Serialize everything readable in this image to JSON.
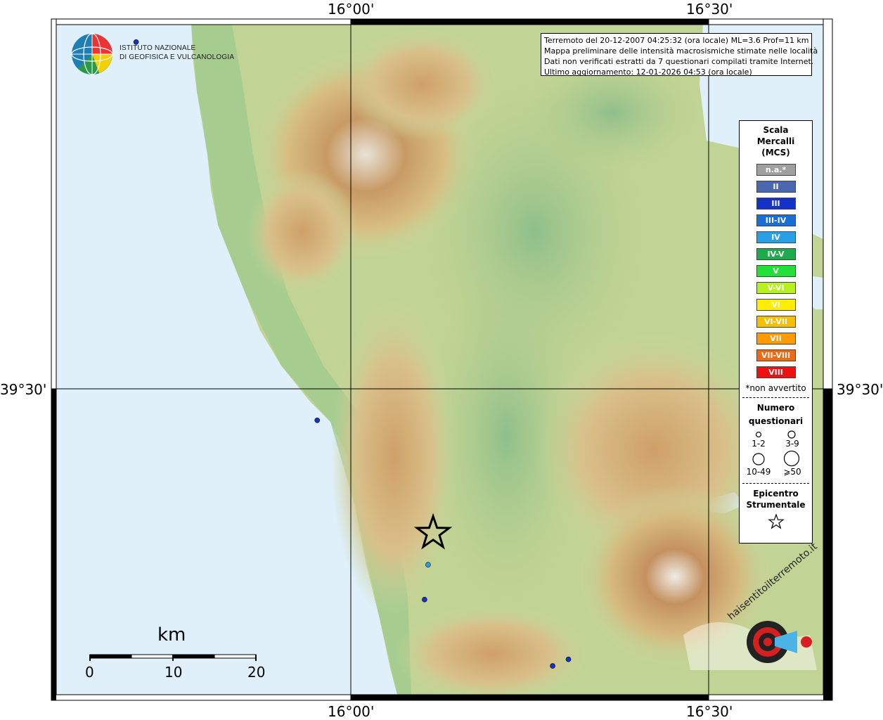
{
  "frame": {
    "lon_top_left": "16°00'",
    "lon_top_right": "16°30'",
    "lon_bottom_left": "16°00'",
    "lon_bottom_right": "16°30'",
    "lat_left": "39°30'",
    "lat_right": "39°30'"
  },
  "info": {
    "line1": "Terremoto del 20-12-2007 04:25:32 (ora locale) ML=3.6 Prof=11 km",
    "line2": "Mappa preliminare delle intensità macrosismiche stimate nelle località",
    "line3": "Dati non verificati estratti da 7 questionari compilati tramite Internet.",
    "line4": "Ultimo aggiornamento: 12-01-2026 04:53 (ora locale)"
  },
  "logo": {
    "line1": "ISTITUTO NAZIONALE",
    "line2": "DI GEOFISICA E VULCANOLOGIA",
    "icon": "ingv-globe-icon"
  },
  "legend": {
    "title1": "Scala",
    "title2": "Mercalli",
    "title3": "(MCS)",
    "classes": [
      {
        "label": "n.a.*",
        "color": "#a0a0a0"
      },
      {
        "label": "II",
        "color": "#4a67b0"
      },
      {
        "label": "III",
        "color": "#1432c8"
      },
      {
        "label": "III-IV",
        "color": "#1a6fd6"
      },
      {
        "label": "IV",
        "color": "#28a0e6"
      },
      {
        "label": "IV-V",
        "color": "#1faa4b"
      },
      {
        "label": "V",
        "color": "#22e038"
      },
      {
        "label": "V-VI",
        "color": "#b6f01e"
      },
      {
        "label": "VI",
        "color": "#ffee00"
      },
      {
        "label": "VI-VII",
        "color": "#f5c000"
      },
      {
        "label": "VII",
        "color": "#ff9a00"
      },
      {
        "label": "VII-VIII",
        "color": "#f06a10"
      },
      {
        "label": "VIII",
        "color": "#ee1111"
      }
    ],
    "note": "*non avvertito",
    "count_title1": "Numero",
    "count_title2": "questionari",
    "sizes": [
      "1-2",
      "3-9",
      "10-49",
      "⩾50"
    ],
    "epi_title1": "Epicentro",
    "epi_title2": "Strumentale"
  },
  "scale": {
    "title": "km",
    "ticks": [
      "0",
      "10",
      "20"
    ]
  },
  "watermark": {
    "text": "haisentitoilterremoto.it",
    "icon": "hst-target-icon"
  },
  "points": [
    {
      "lon": 15.7,
      "lat": 39.918,
      "color": "#1432c8"
    },
    {
      "lon": 15.953,
      "lat": 39.462,
      "color": "#1432c8"
    },
    {
      "lon": 16.108,
      "lat": 39.288,
      "color": "#28a0e6"
    },
    {
      "lon": 16.103,
      "lat": 39.246,
      "color": "#1432c8"
    },
    {
      "lon": 16.304,
      "lat": 39.174,
      "color": "#1432c8"
    },
    {
      "lon": 16.282,
      "lat": 39.166,
      "color": "#1432c8"
    }
  ],
  "epicenter": {
    "lon": 16.115,
    "lat": 39.326
  }
}
